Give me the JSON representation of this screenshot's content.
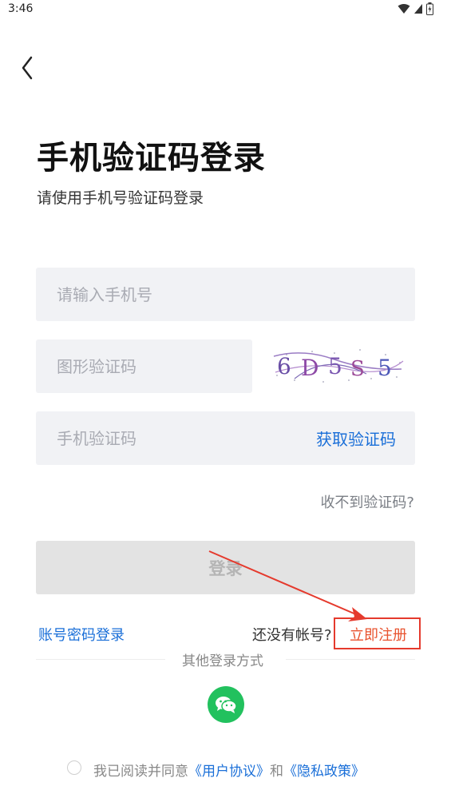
{
  "status_bar": {
    "time": "3:46"
  },
  "header": {
    "title": "手机验证码登录",
    "subtitle": "请使用手机号验证码登录"
  },
  "form": {
    "phone_placeholder": "请输入手机号",
    "captcha_placeholder": "图形验证码",
    "captcha_image_text": "6D5S5",
    "sms_placeholder": "手机验证码",
    "get_code_label": "获取验证码",
    "no_code_link": "收不到验证码?",
    "login_button": "登录"
  },
  "links": {
    "password_login": "账号密码登录",
    "no_account": "还没有帐号?",
    "register": "立即注册"
  },
  "other_login": {
    "label": "其他登录方式",
    "icons": [
      "wechat-icon"
    ]
  },
  "agreement": {
    "prefix": "我已阅读并同意",
    "user_agreement": "《用户协议》",
    "and": "和",
    "privacy_policy": "《隐私政策》"
  },
  "colors": {
    "link_blue": "#1a6fd8",
    "register_red": "#e8532f",
    "annotation_red": "#e53a2d",
    "wechat_green": "#22c15e"
  }
}
